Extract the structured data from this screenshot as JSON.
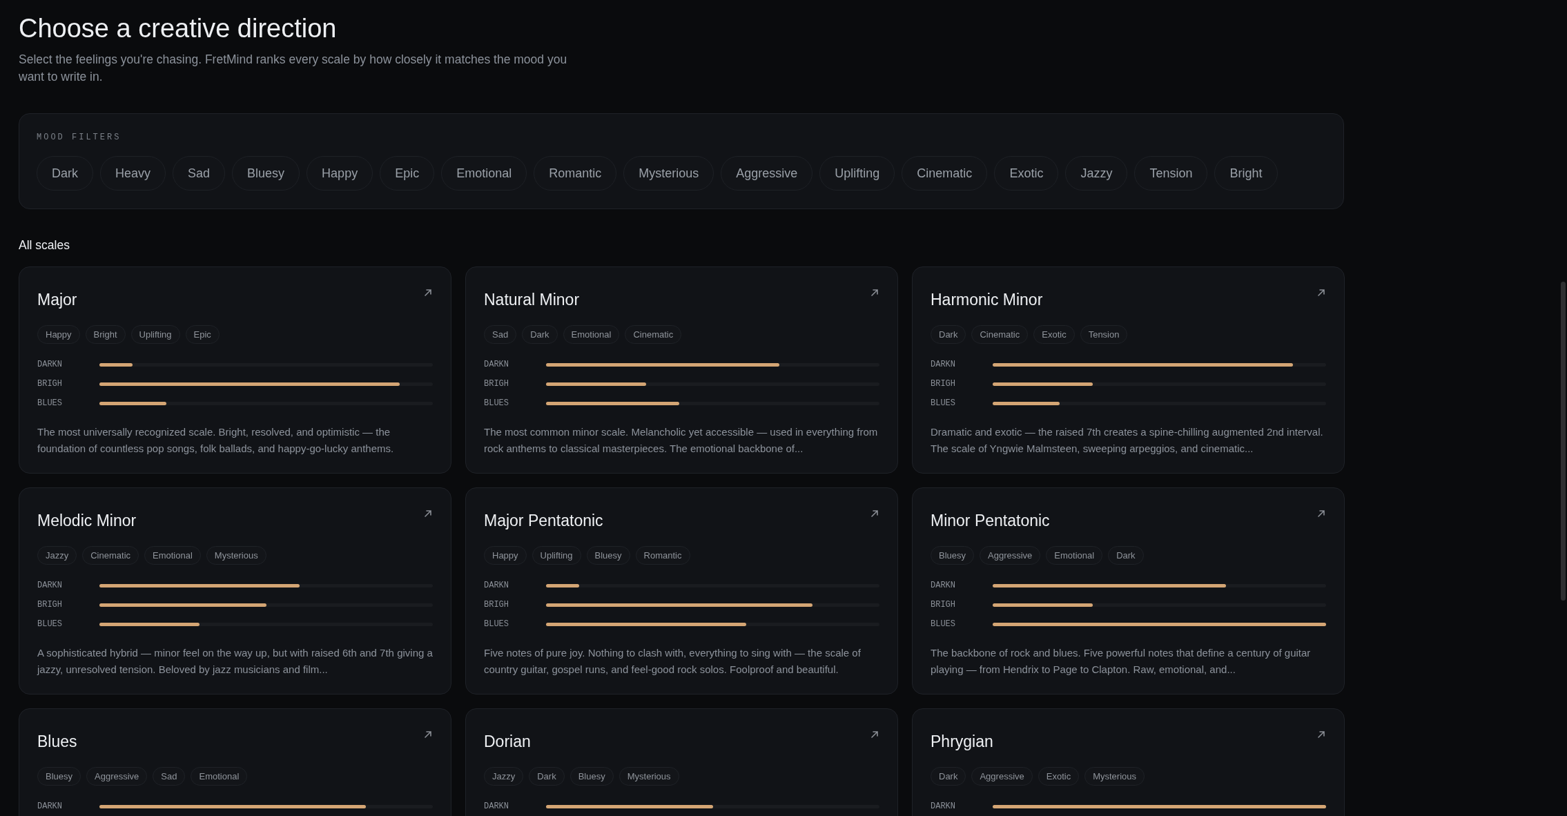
{
  "header": {
    "title": "Choose a creative direction",
    "subtitle": "Select the feelings you're chasing. FretMind ranks every scale by how closely it matches the mood you want to write in."
  },
  "mood_filters": {
    "label": "MOOD FILTERS",
    "chips": [
      {
        "label": "Dark",
        "selected": false
      },
      {
        "label": "Heavy",
        "selected": false
      },
      {
        "label": "Sad",
        "selected": false
      },
      {
        "label": "Bluesy",
        "selected": false
      },
      {
        "label": "Happy",
        "selected": false
      },
      {
        "label": "Epic",
        "selected": false
      },
      {
        "label": "Emotional",
        "selected": false
      },
      {
        "label": "Romantic",
        "selected": false
      },
      {
        "label": "Mysterious",
        "selected": false
      },
      {
        "label": "Aggressive",
        "selected": false
      },
      {
        "label": "Uplifting",
        "selected": false
      },
      {
        "label": "Cinematic",
        "selected": false
      },
      {
        "label": "Exotic",
        "selected": false
      },
      {
        "label": "Jazzy",
        "selected": false
      },
      {
        "label": "Tension",
        "selected": false
      },
      {
        "label": "Bright",
        "selected": false
      }
    ]
  },
  "section_title": "All scales",
  "scales": [
    {
      "name": "Major",
      "tags": [
        "Happy",
        "Bright",
        "Uplifting",
        "Epic"
      ],
      "metrics": [
        {
          "label": "DARKN",
          "level": 0.1
        },
        {
          "label": "BRIGH",
          "level": 0.9
        },
        {
          "label": "BLUES",
          "level": 0.2
        }
      ],
      "description": "The most universally recognized scale. Bright, resolved, and optimistic — the foundation of countless pop songs, folk ballads, and happy-go-lucky anthems."
    },
    {
      "name": "Natural Minor",
      "tags": [
        "Sad",
        "Dark",
        "Emotional",
        "Cinematic"
      ],
      "metrics": [
        {
          "label": "DARKN",
          "level": 0.7
        },
        {
          "label": "BRIGH",
          "level": 0.3
        },
        {
          "label": "BLUES",
          "level": 0.4
        }
      ],
      "description": "The most common minor scale. Melancholic yet accessible — used in everything from rock anthems to classical masterpieces. The emotional backbone of..."
    },
    {
      "name": "Harmonic Minor",
      "tags": [
        "Dark",
        "Cinematic",
        "Exotic",
        "Tension"
      ],
      "metrics": [
        {
          "label": "DARKN",
          "level": 0.9
        },
        {
          "label": "BRIGH",
          "level": 0.3
        },
        {
          "label": "BLUES",
          "level": 0.2
        }
      ],
      "description": "Dramatic and exotic — the raised 7th creates a spine-chilling augmented 2nd interval. The scale of Yngwie Malmsteen, sweeping arpeggios, and cinematic..."
    },
    {
      "name": "Melodic Minor",
      "tags": [
        "Jazzy",
        "Cinematic",
        "Emotional",
        "Mysterious"
      ],
      "metrics": [
        {
          "label": "DARKN",
          "level": 0.6
        },
        {
          "label": "BRIGH",
          "level": 0.5
        },
        {
          "label": "BLUES",
          "level": 0.3
        }
      ],
      "description": "A sophisticated hybrid — minor feel on the way up, but with raised 6th and 7th giving a jazzy, unresolved tension. Beloved by jazz musicians and film..."
    },
    {
      "name": "Major Pentatonic",
      "tags": [
        "Happy",
        "Uplifting",
        "Bluesy",
        "Romantic"
      ],
      "metrics": [
        {
          "label": "DARKN",
          "level": 0.1
        },
        {
          "label": "BRIGH",
          "level": 0.8
        },
        {
          "label": "BLUES",
          "level": 0.6
        }
      ],
      "description": "Five notes of pure joy. Nothing to clash with, everything to sing with — the scale of country guitar, gospel runs, and feel-good rock solos. Foolproof and beautiful."
    },
    {
      "name": "Minor Pentatonic",
      "tags": [
        "Bluesy",
        "Aggressive",
        "Emotional",
        "Dark"
      ],
      "metrics": [
        {
          "label": "DARKN",
          "level": 0.7
        },
        {
          "label": "BRIGH",
          "level": 0.3
        },
        {
          "label": "BLUES",
          "level": 1.0
        }
      ],
      "description": "The backbone of rock and blues. Five powerful notes that define a century of guitar playing — from Hendrix to Page to Clapton. Raw, emotional, and..."
    },
    {
      "name": "Blues",
      "tags": [
        "Bluesy",
        "Aggressive",
        "Sad",
        "Emotional"
      ],
      "metrics": [
        {
          "label": "DARKN",
          "level": 0.8
        }
      ]
    },
    {
      "name": "Dorian",
      "tags": [
        "Jazzy",
        "Dark",
        "Bluesy",
        "Mysterious"
      ],
      "metrics": [
        {
          "label": "DARKN",
          "level": 0.5
        }
      ]
    },
    {
      "name": "Phrygian",
      "tags": [
        "Dark",
        "Aggressive",
        "Exotic",
        "Mysterious"
      ],
      "metrics": [
        {
          "label": "DARKN",
          "level": 1.0
        }
      ]
    }
  ]
}
